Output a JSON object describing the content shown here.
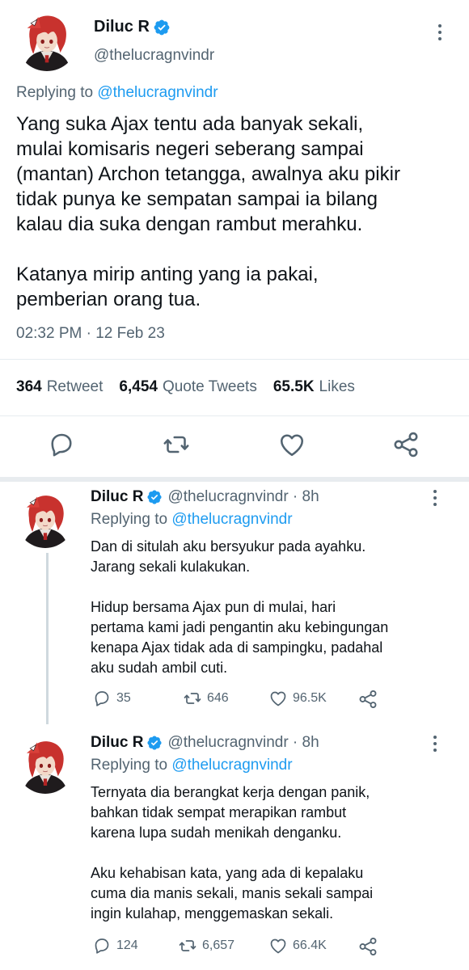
{
  "main_tweet": {
    "author_name": "Diluc R",
    "handle": "@thelucragnvindr",
    "replying_label": "Replying to",
    "replying_handle": "@thelucragnvindr",
    "text": "Yang suka Ajax tentu ada banyak sekali,\nmulai komisaris negeri seberang sampai\n(mantan) Archon tetangga, awalnya aku pikir\ntidak punya ke sempatan sampai ia bilang\nkalau dia suka dengan rambut merahku.\n\nKatanya mirip anting yang ia pakai,\npemberian orang tua.",
    "timestamp": "02:32 PM · 12 Feb 23",
    "stats": {
      "retweets": "364",
      "retweets_label": "Retweet",
      "quotes": "6,454",
      "quotes_label": "Quote Tweets",
      "likes": "65.5K",
      "likes_label": "Likes"
    },
    "icons": [
      "reply-icon",
      "retweet-icon",
      "like-icon",
      "share-icon"
    ]
  },
  "replies": [
    {
      "author_name": "Diluc R",
      "meta": "@thelucragnvindr · 8h",
      "replying_label": "Replying to",
      "replying_handle": "@thelucragnvindr",
      "text": "Dan di situlah aku bersyukur pada ayahku.\nJarang sekali kulakukan.\n\nHidup bersama Ajax pun di mulai, hari\npertama kami jadi pengantin aku kebingungan\nkenapa Ajax tidak ada di sampingku, padahal\naku sudah ambil cuti.",
      "replies": "35",
      "retweets": "646",
      "likes": "96.5K"
    },
    {
      "author_name": "Diluc R",
      "meta": "@thelucragnvindr · 8h",
      "replying_label": "Replying to",
      "replying_handle": "@thelucragnvindr",
      "text": "Ternyata dia berangkat kerja dengan panik,\nbahkan tidak sempat merapikan rambut\nkarena lupa sudah menikah denganku.\n\nAku kehabisan kata, yang ada di kepalaku\ncuma dia manis sekali, manis sekali sampai\ningin kulahap, menggemaskan sekali.",
      "replies": "124",
      "retweets": "6,657",
      "likes": "66.4K"
    }
  ],
  "colors": {
    "accent": "#1d9bf0",
    "text": "#0f1419",
    "secondary": "#536471",
    "divider": "#e6ecf0",
    "hair": "#c8322e",
    "outfit": "#1f1b1d"
  }
}
